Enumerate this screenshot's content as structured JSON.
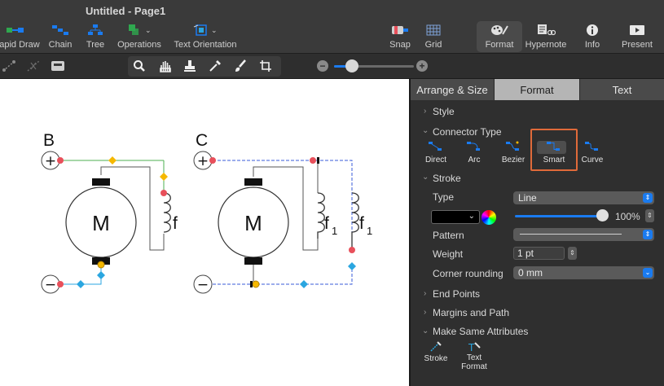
{
  "window": {
    "title": "Untitled - Page1"
  },
  "toolbar": {
    "rapid_draw": "Rapid Draw",
    "chain": "Chain",
    "tree": "Tree",
    "operations": "Operations",
    "text_orientation": "Text Orientation",
    "snap": "Snap",
    "grid": "Grid",
    "format": "Format",
    "hypernote": "Hypernote",
    "info": "Info",
    "present": "Present"
  },
  "zoom": {
    "minus": "−",
    "plus": "+",
    "level": 0.2
  },
  "canvas": {
    "label_b": "B",
    "label_c": "C",
    "motor1": "M",
    "motor2": "M",
    "winding1": "f",
    "winding2": "f",
    "winding2_sub": "1",
    "winding3": "f",
    "winding3_sub": "1",
    "plus": "+",
    "minus": "−"
  },
  "inspector": {
    "tabs": [
      "Arrange & Size",
      "Format",
      "Text"
    ],
    "active_tab": "Format",
    "style": "Style",
    "connector_type": "Connector Type",
    "connectors": [
      "Direct",
      "Arc",
      "Bezier",
      "Smart",
      "Curve"
    ],
    "selected_connector": "Smart",
    "stroke": "Stroke",
    "type_label": "Type",
    "type_value": "Line",
    "opacity": "100%",
    "pattern_label": "Pattern",
    "weight_label": "Weight",
    "weight_value": "1 pt",
    "corner_label": "Corner rounding",
    "corner_value": "0 mm",
    "end_points": "End Points",
    "margins_path": "Margins and Path",
    "make_same": "Make Same Attributes",
    "same_items": [
      "Stroke",
      "Text Format"
    ]
  },
  "colors": {
    "accent": "#1a7bf0",
    "highlight": "#e06a3a",
    "green_line": "#4caf50",
    "dashed_line": "#3a5bd9",
    "red_node": "#e8505b",
    "diamond_yellow": "#f5b800",
    "diamond_blue": "#2aa6e0"
  }
}
